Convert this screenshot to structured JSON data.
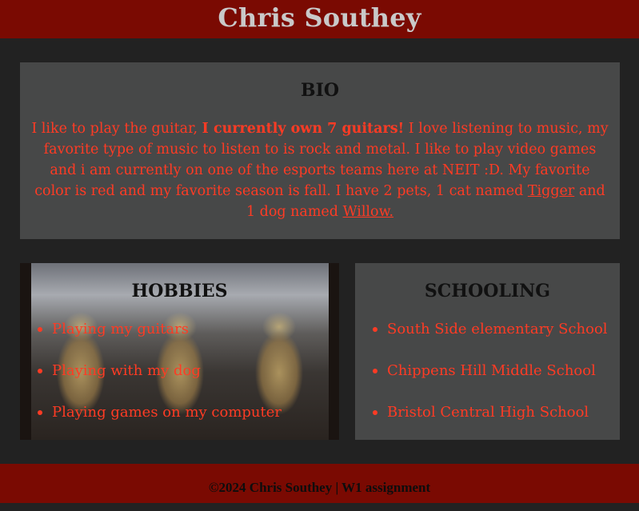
{
  "header": {
    "title": "Chris Southey"
  },
  "bio": {
    "heading": "BIO",
    "text_1": "I like to play the guitar, ",
    "text_bold": "I currently own 7 guitars!",
    "text_2": " I love listening to music, my favorite type of music to listen to is rock and metal. I like to play video games and i am currently on one of the esports teams here at NEIT :D. My favorite color is red and my favorite season is fall. I have 2 pets, 1 cat named ",
    "link_cat": "Tigger",
    "text_3": " and 1 dog named ",
    "link_dog": "Willow."
  },
  "hobbies": {
    "heading": "HOBBIES",
    "items": [
      "Playing my guitars",
      "Playing with my dog",
      "Playing games on my computer"
    ]
  },
  "schooling": {
    "heading": "SCHOOLING",
    "items": [
      "South Side elementary School",
      "Chippens Hill Middle School",
      "Bristol Central High School"
    ]
  },
  "footer": {
    "text": "©2024 Chris Southey | W1 assignment"
  },
  "colors": {
    "header_bg": "#7a0a02",
    "page_bg": "#222222",
    "card_bg": "#474848",
    "accent_text": "#ff3b24"
  }
}
